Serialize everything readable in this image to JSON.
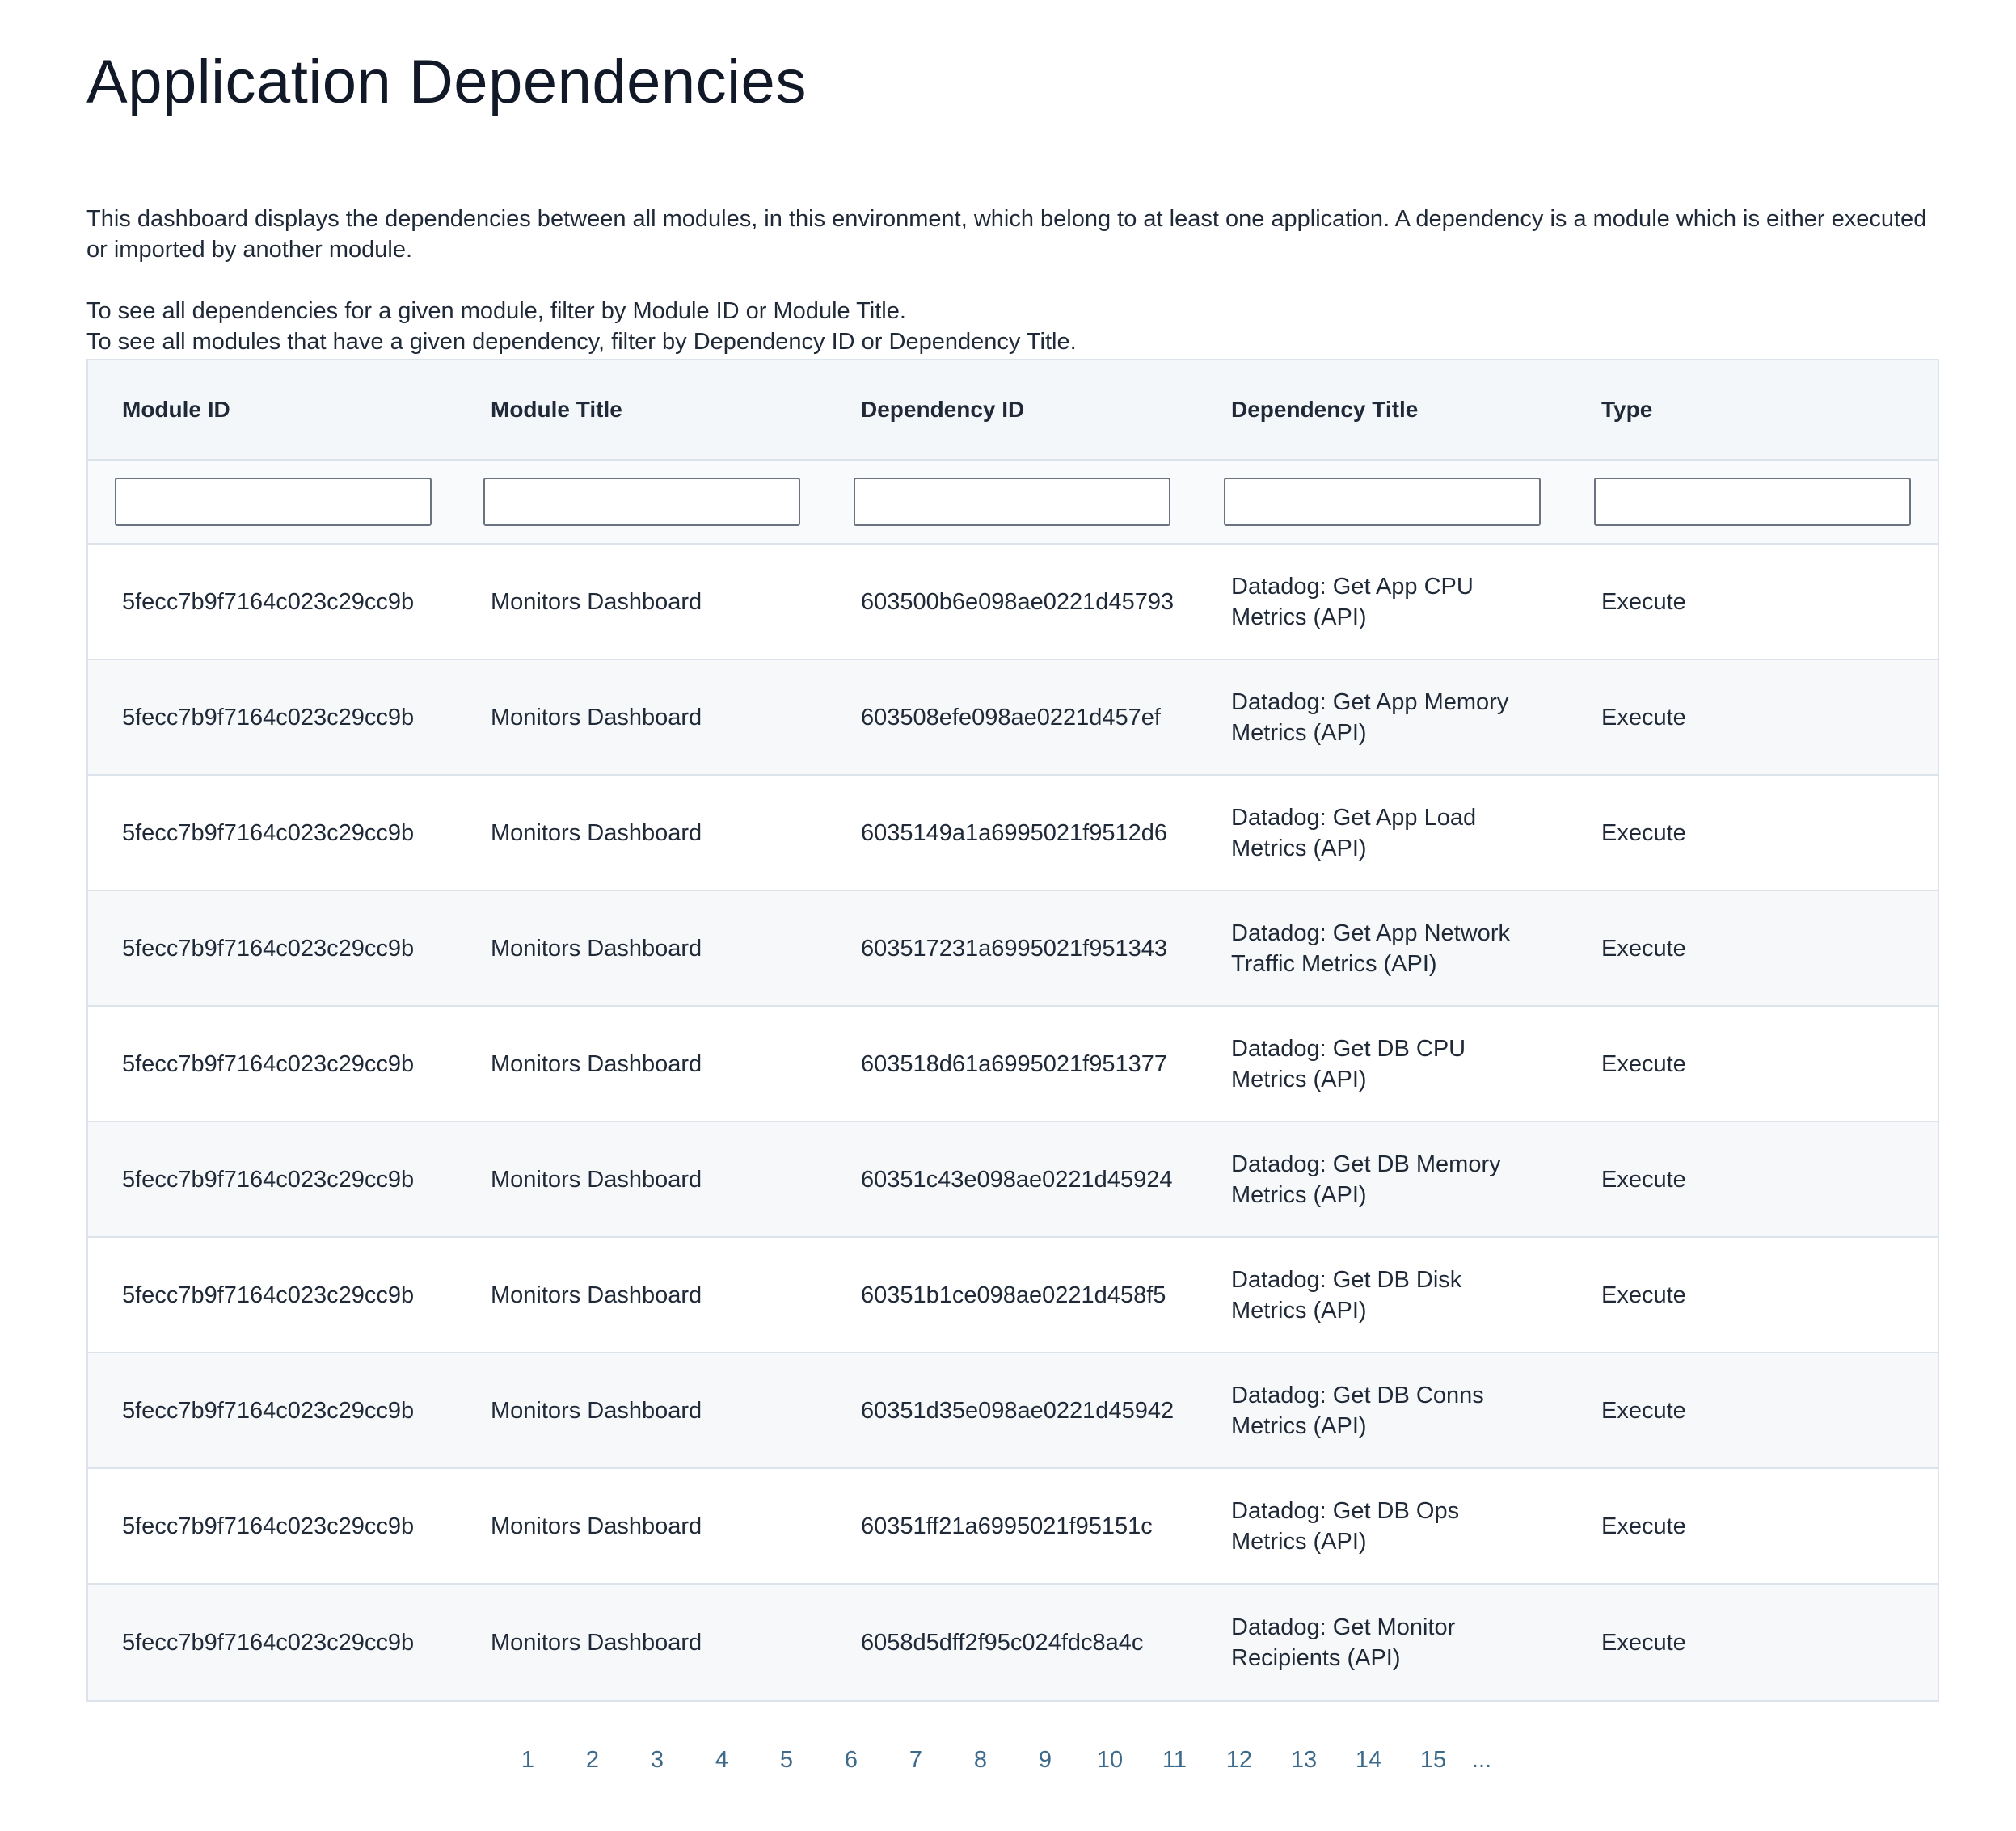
{
  "page": {
    "title": "Application Dependencies",
    "description_1": "This dashboard displays the dependencies between all modules, in this environment, which belong to at least one application. A dependency is a module which is either executed or imported by another module.",
    "description_2": "To see all dependencies for a given module, filter by Module ID or Module Title.",
    "description_3": "To see all modules that have a given dependency, filter by Dependency ID or Dependency Title."
  },
  "table": {
    "columns": [
      "Module ID",
      "Module Title",
      "Dependency ID",
      "Dependency Title",
      "Type"
    ],
    "filters": [
      "",
      "",
      "",
      "",
      ""
    ],
    "rows": [
      [
        "5fecc7b9f7164c023c29cc9b",
        "Monitors Dashboard",
        "603500b6e098ae0221d45793",
        "Datadog: Get App CPU Metrics (API)",
        "Execute"
      ],
      [
        "5fecc7b9f7164c023c29cc9b",
        "Monitors Dashboard",
        "603508efe098ae0221d457ef",
        "Datadog: Get App Memory Metrics (API)",
        "Execute"
      ],
      [
        "5fecc7b9f7164c023c29cc9b",
        "Monitors Dashboard",
        "6035149a1a6995021f9512d6",
        "Datadog: Get App Load Metrics (API)",
        "Execute"
      ],
      [
        "5fecc7b9f7164c023c29cc9b",
        "Monitors Dashboard",
        "603517231a6995021f951343",
        "Datadog: Get App Network Traffic Metrics (API)",
        "Execute"
      ],
      [
        "5fecc7b9f7164c023c29cc9b",
        "Monitors Dashboard",
        "603518d61a6995021f951377",
        "Datadog: Get DB CPU Metrics (API)",
        "Execute"
      ],
      [
        "5fecc7b9f7164c023c29cc9b",
        "Monitors Dashboard",
        "60351c43e098ae0221d45924",
        "Datadog: Get DB Memory Metrics (API)",
        "Execute"
      ],
      [
        "5fecc7b9f7164c023c29cc9b",
        "Monitors Dashboard",
        "60351b1ce098ae0221d458f5",
        "Datadog: Get DB Disk Metrics (API)",
        "Execute"
      ],
      [
        "5fecc7b9f7164c023c29cc9b",
        "Monitors Dashboard",
        "60351d35e098ae0221d45942",
        "Datadog: Get DB Conns Metrics (API)",
        "Execute"
      ],
      [
        "5fecc7b9f7164c023c29cc9b",
        "Monitors Dashboard",
        "60351ff21a6995021f95151c",
        "Datadog: Get DB Ops Metrics (API)",
        "Execute"
      ],
      [
        "5fecc7b9f7164c023c29cc9b",
        "Monitors Dashboard",
        "6058d5dff2f95c024fdc8a4c",
        "Datadog: Get Monitor Recipients (API)",
        "Execute"
      ]
    ]
  },
  "pagination": {
    "pages": [
      "1",
      "2",
      "3",
      "4",
      "5",
      "6",
      "7",
      "8",
      "9",
      "10",
      "11",
      "12",
      "13",
      "14",
      "15"
    ],
    "ellipsis": "..."
  },
  "colors": {
    "link": "#3d6a8a",
    "header_bg": "#f4f7fa",
    "alt_row_bg": "#f6f8fa",
    "border": "#dde3ea"
  }
}
